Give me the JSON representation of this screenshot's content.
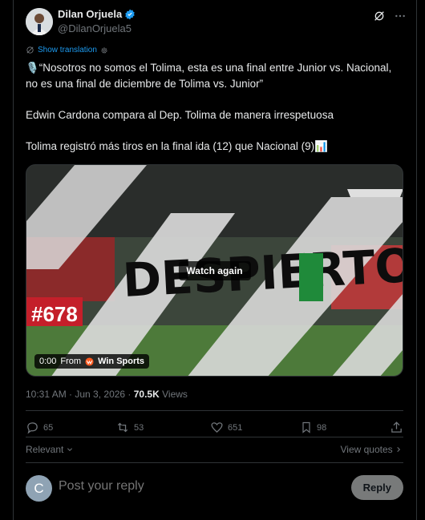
{
  "author": {
    "name": "Dilan Orjuela",
    "handle": "@DilanOrjuela5"
  },
  "translate_label": "Show translation",
  "tweet": {
    "line1": "🎙️“Nosotros no somos el Tolima, esta es una final entre Junior vs. Nacional, no es una final de diciembre de Tolima vs. Junior”",
    "line2": "Edwin Cardona compara al Dep. Tolima de manera irrespetuosa",
    "line3": "Tolima registró más tiros en la final ida (12) que Nacional (9)📊"
  },
  "media": {
    "watch_again": "Watch again",
    "time": "0:00",
    "from_label": "From",
    "source": "Win Sports",
    "overlay_text": "DESPIERTO",
    "scoreboard": "#678"
  },
  "meta": {
    "time": "10:31 AM · Jun 3, 2026 · ",
    "views_count": "70.5K",
    "views_label": " Views"
  },
  "actions": {
    "replies": "65",
    "reposts": "53",
    "likes": "651",
    "bookmarks": "98"
  },
  "sort": {
    "label": "Relevant",
    "quotes_label": "View quotes"
  },
  "reply": {
    "avatar_letter": "C",
    "placeholder": "Post your reply",
    "button": "Reply"
  },
  "colors": {
    "link": "#1d9bf0",
    "muted": "#71767b",
    "verified": "#1d9bf0"
  }
}
